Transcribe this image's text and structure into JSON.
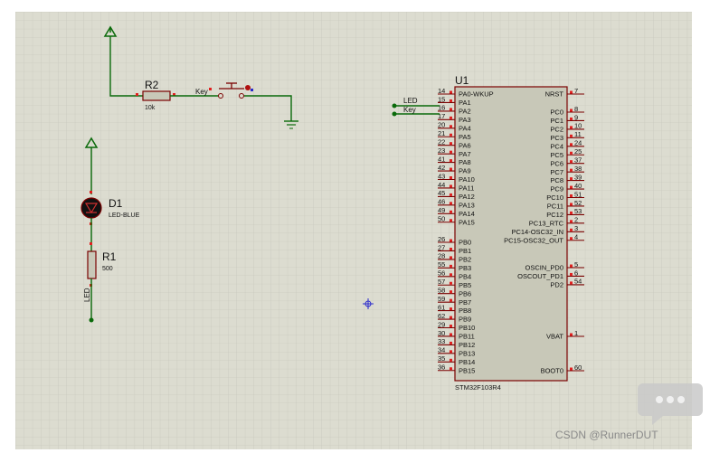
{
  "schematic": {
    "colors": {
      "sheet": "#dcdcd0",
      "grid": "#c4c4b8",
      "wire": "#0a6a0a",
      "outline": "#7a0000",
      "chip_fill": "#c8c8b8",
      "pin_marker": "#e02020",
      "origin_marker": "#2a2acc"
    },
    "r2": {
      "ref": "R2",
      "value": "10k",
      "net": "Key"
    },
    "key_switch": {
      "net": "Key"
    },
    "d1": {
      "ref": "D1",
      "value": "LED-BLUE"
    },
    "r1": {
      "ref": "R1",
      "value": "500",
      "net": "LED"
    },
    "nets": {
      "led": "LED",
      "key": "Key"
    },
    "u1": {
      "ref": "U1",
      "part": "STM32F103R4",
      "left_pins": [
        {
          "num": "14",
          "name": "PA0-WKUP"
        },
        {
          "num": "15",
          "name": "PA1"
        },
        {
          "num": "16",
          "name": "PA2"
        },
        {
          "num": "17",
          "name": "PA3"
        },
        {
          "num": "20",
          "name": "PA4"
        },
        {
          "num": "21",
          "name": "PA5"
        },
        {
          "num": "22",
          "name": "PA6"
        },
        {
          "num": "23",
          "name": "PA7"
        },
        {
          "num": "41",
          "name": "PA8"
        },
        {
          "num": "42",
          "name": "PA9"
        },
        {
          "num": "43",
          "name": "PA10"
        },
        {
          "num": "44",
          "name": "PA11"
        },
        {
          "num": "45",
          "name": "PA12"
        },
        {
          "num": "46",
          "name": "PA13"
        },
        {
          "num": "49",
          "name": "PA14"
        },
        {
          "num": "50",
          "name": "PA15"
        },
        {
          "num": "26",
          "name": "PB0"
        },
        {
          "num": "27",
          "name": "PB1"
        },
        {
          "num": "28",
          "name": "PB2"
        },
        {
          "num": "55",
          "name": "PB3"
        },
        {
          "num": "56",
          "name": "PB4"
        },
        {
          "num": "57",
          "name": "PB5"
        },
        {
          "num": "58",
          "name": "PB6"
        },
        {
          "num": "59",
          "name": "PB7"
        },
        {
          "num": "61",
          "name": "PB8"
        },
        {
          "num": "62",
          "name": "PB9"
        },
        {
          "num": "29",
          "name": "PB10"
        },
        {
          "num": "30",
          "name": "PB11"
        },
        {
          "num": "33",
          "name": "PB12"
        },
        {
          "num": "34",
          "name": "PB13"
        },
        {
          "num": "35",
          "name": "PB14"
        },
        {
          "num": "36",
          "name": "PB15"
        }
      ],
      "right_pins": [
        {
          "num": "7",
          "name": "NRST"
        },
        {
          "num": "8",
          "name": "PC0"
        },
        {
          "num": "9",
          "name": "PC1"
        },
        {
          "num": "10",
          "name": "PC2"
        },
        {
          "num": "11",
          "name": "PC3"
        },
        {
          "num": "24",
          "name": "PC4"
        },
        {
          "num": "25",
          "name": "PC5"
        },
        {
          "num": "37",
          "name": "PC6"
        },
        {
          "num": "38",
          "name": "PC7"
        },
        {
          "num": "39",
          "name": "PC8"
        },
        {
          "num": "40",
          "name": "PC9"
        },
        {
          "num": "51",
          "name": "PC10"
        },
        {
          "num": "52",
          "name": "PC11"
        },
        {
          "num": "53",
          "name": "PC12"
        },
        {
          "num": "2",
          "name": "PC13_RTC"
        },
        {
          "num": "3",
          "name": "PC14-OSC32_IN"
        },
        {
          "num": "4",
          "name": "PC15-OSC32_OUT"
        },
        {
          "num": "5",
          "name": "OSCIN_PD0"
        },
        {
          "num": "6",
          "name": "OSCOUT_PD1"
        },
        {
          "num": "54",
          "name": "PD2"
        },
        {
          "num": "1",
          "name": "VBAT"
        },
        {
          "num": "60",
          "name": "BOOT0"
        }
      ]
    },
    "watermark": "CSDN @RunnerDUT"
  }
}
